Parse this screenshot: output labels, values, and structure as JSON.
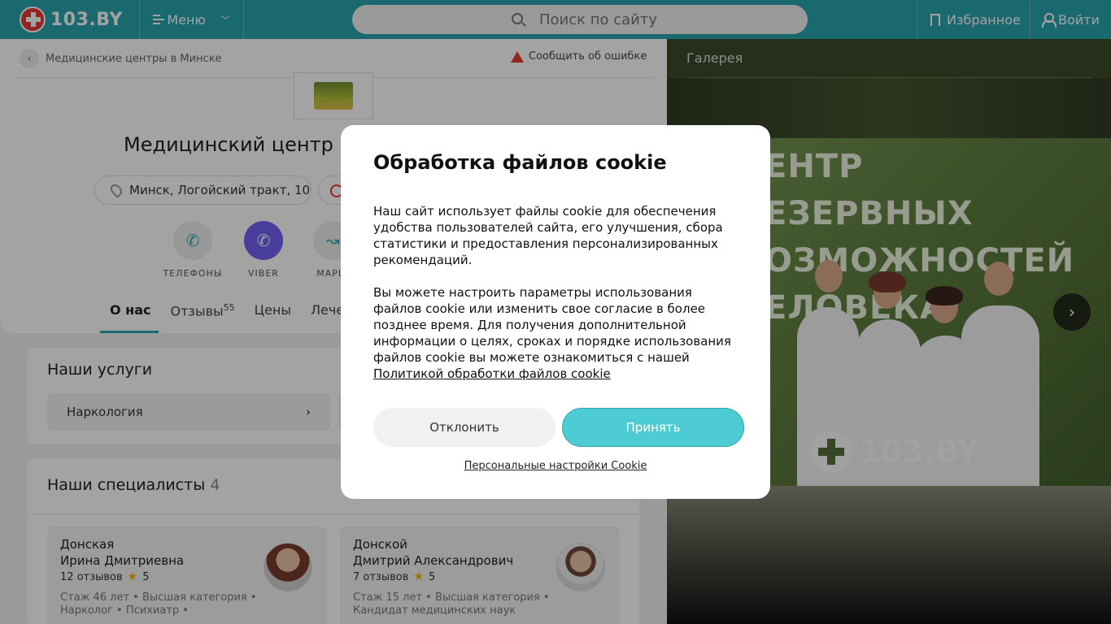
{
  "header": {
    "logo_text": "103.BY",
    "menu_label": "Меню",
    "search_placeholder": "Поиск по сайту",
    "favorites_label": "Избранное",
    "login_label": "Войти"
  },
  "breadcrumb": {
    "label": "Медицинские центры в Минске",
    "report_label": "Сообщить об ошибке"
  },
  "clinic": {
    "title": "Медицинский центр",
    "address": "Минск, Логойский тракт, 10"
  },
  "actions": [
    {
      "label": "ТЕЛЕФОНЫ",
      "icon": "phone-icon"
    },
    {
      "label": "VIBER",
      "icon": "viber-icon"
    },
    {
      "label": "МАРШ",
      "icon": "route-icon"
    }
  ],
  "tabs": [
    {
      "label": "О нас",
      "active": true
    },
    {
      "label": "Отзывы",
      "count": "55"
    },
    {
      "label": "Цены"
    },
    {
      "label": "Лечен"
    }
  ],
  "services": {
    "title": "Наши услуги",
    "items": [
      "Наркология"
    ]
  },
  "specialists": {
    "title": "Наши специалисты",
    "count": "4",
    "doctors": [
      {
        "last_name": "Донская",
        "first_names": "Ирина Дмитриевна",
        "reviews": "12 отзывов",
        "rating": "5",
        "info_line1": "Стаж 46 лет • Высшая категория •",
        "info_line2": "Нарколог • Психиатр •"
      },
      {
        "last_name": "Донской",
        "first_names": "Дмитрий Александрович",
        "reviews": "7 отзывов",
        "rating": "5",
        "info_line1": "Стаж 15 лет • Высшая категория •",
        "info_line2": "Кандидат медицинских наук"
      }
    ]
  },
  "gallery": {
    "title": "Галерея",
    "photo_caption_lines": [
      "ЕНТР",
      "ЕЗЕРВНЫХ",
      "ОЗМОЖНОСТЕЙ",
      "ЕЛОВЕКА"
    ],
    "watermark": "103.BY"
  },
  "cookie_dialog": {
    "title": "Обработка файлов cookie",
    "paragraph1": "Наш сайт использует файлы cookie для обеспечения удобства пользователей сайта, его улучшения, сбора статистики и предоставления персонализированных рекомендаций.",
    "paragraph2": "Вы можете настроить параметры использования файлов cookie или изменить свое согласие в более позднее время. Для получения дополнительной информации о целях, сроках и порядке использования файлов cookie вы можете ознакомиться с нашей",
    "policy_link": "Политикой обработки файлов cookie",
    "decline_label": "Отклонить",
    "accept_label": "Принять",
    "settings_link": "Персональные настройки Cookie"
  },
  "colors": {
    "brand": "#2aa4ae",
    "accept_button": "#4dccd3",
    "viber": "#7360f2",
    "alert": "#e53935",
    "star": "#f5b400"
  }
}
